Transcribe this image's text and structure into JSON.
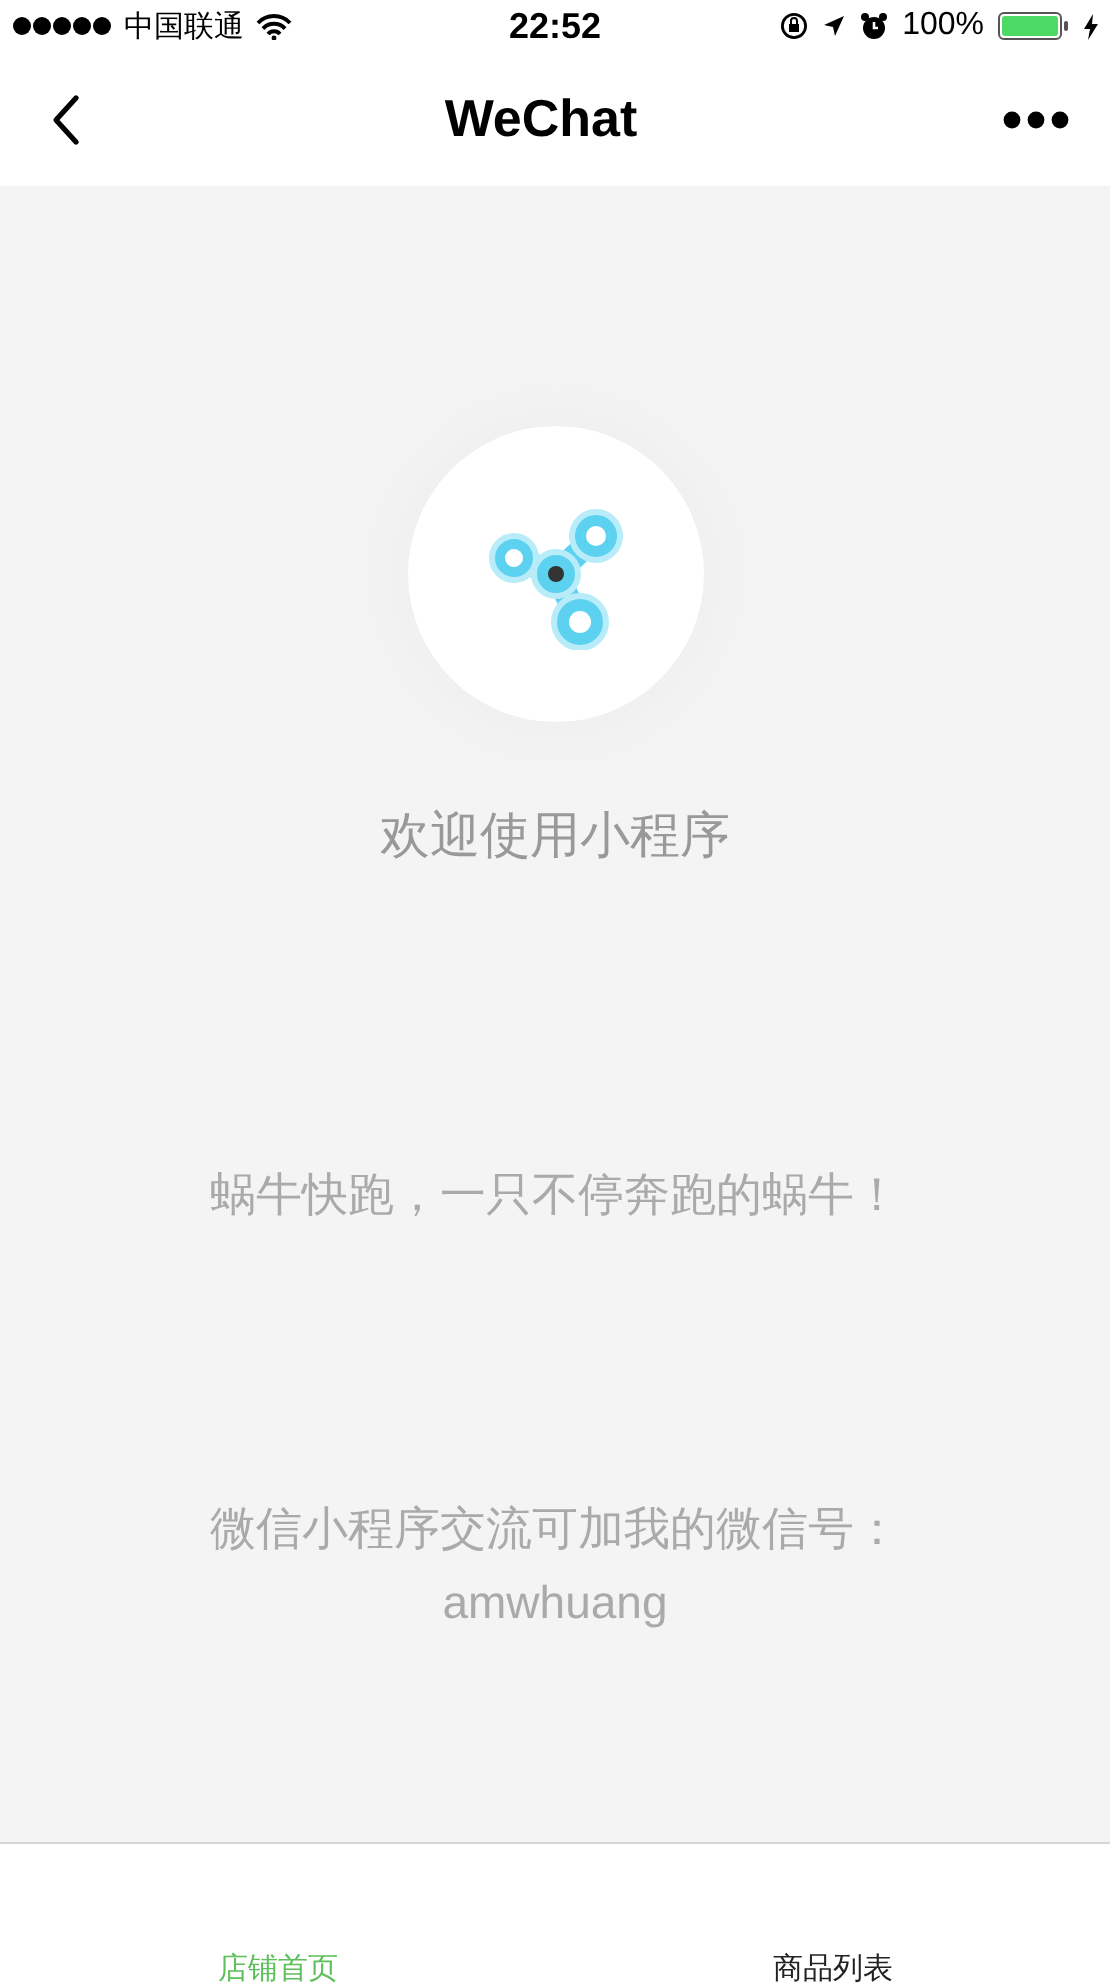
{
  "status_bar": {
    "carrier": "中国联通",
    "time": "22:52",
    "battery": "100%"
  },
  "nav": {
    "title": "WeChat"
  },
  "welcome": "欢迎使用小程序",
  "slogan": "蜗牛快跑，一只不停奔跑的蜗牛！",
  "contact": {
    "line": "微信小程序交流可加我的微信号：",
    "wechat_id": "amwhuang"
  },
  "tabs": [
    {
      "label": "店铺首页",
      "selected": true
    },
    {
      "label": "商品列表",
      "selected": false
    }
  ]
}
